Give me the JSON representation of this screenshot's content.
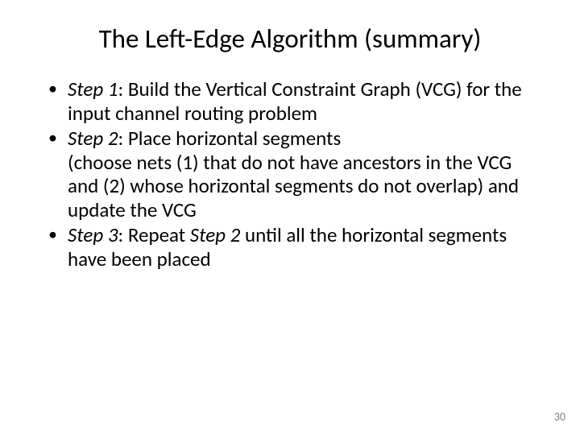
{
  "title": "The Left-Edge Algorithm (summary)",
  "steps": [
    {
      "label": "Step 1",
      "text": ": Build the Vertical Constraint Graph (VCG) for the input channel routing problem"
    },
    {
      "label": "Step 2",
      "text_a": ": Place horizontal segments",
      "text_b": "(choose nets (1) that do not have ancestors in the VCG and (2) whose horizontal segments do not overlap) and update the VCG"
    },
    {
      "label": "Step 3",
      "text_a": ": Repeat ",
      "label2": "Step 2",
      "text_b": " until all the horizontal segments have been placed"
    }
  ],
  "page_number": "30"
}
